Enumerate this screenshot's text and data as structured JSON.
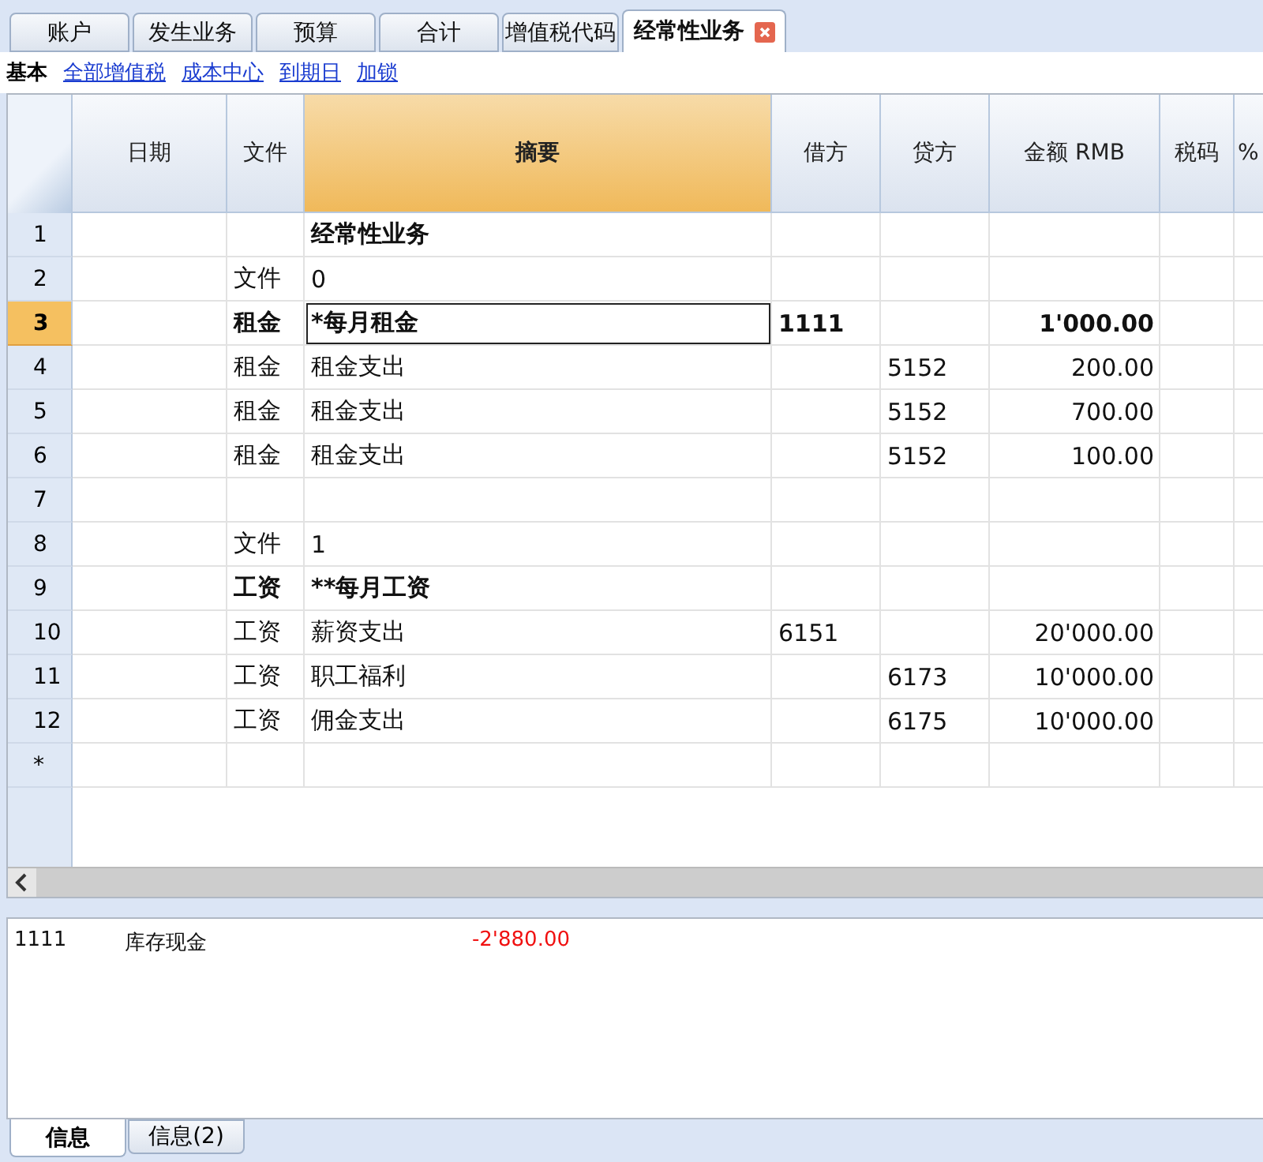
{
  "tabs": [
    {
      "label": "账户",
      "selected": false
    },
    {
      "label": "发生业务",
      "selected": false
    },
    {
      "label": "预算",
      "selected": false
    },
    {
      "label": "合计",
      "selected": false
    },
    {
      "label": "增值税代码",
      "selected": false
    },
    {
      "label": "经常性业务",
      "selected": true,
      "closable": true
    }
  ],
  "views": [
    {
      "label": "基本",
      "selected": true
    },
    {
      "label": "全部增值税",
      "selected": false
    },
    {
      "label": "成本中心",
      "selected": false
    },
    {
      "label": "到期日",
      "selected": false
    },
    {
      "label": "加锁",
      "selected": false
    }
  ],
  "table": {
    "columns": [
      {
        "label": "日期",
        "selected": false
      },
      {
        "label": "文件",
        "selected": false
      },
      {
        "label": "摘要",
        "selected": true
      },
      {
        "label": "借方",
        "selected": false
      },
      {
        "label": "贷方",
        "selected": false
      },
      {
        "label": "金额 RMB",
        "selected": false
      },
      {
        "label": "税码",
        "selected": false
      },
      {
        "label": "%",
        "selected": false
      }
    ],
    "rows": [
      {
        "number": "1",
        "selected": false,
        "bold": true,
        "cells": [
          "",
          "",
          "经常性业务",
          "",
          "",
          "",
          "",
          ""
        ]
      },
      {
        "number": "2",
        "selected": false,
        "bold": false,
        "cells": [
          "",
          "文件",
          "0",
          "",
          "",
          "",
          "",
          ""
        ]
      },
      {
        "number": "3",
        "selected": true,
        "bold": true,
        "cells": [
          "",
          "租金",
          "*每月租金",
          "1111",
          "",
          "1'000.00",
          "",
          ""
        ]
      },
      {
        "number": "4",
        "selected": false,
        "bold": false,
        "cells": [
          "",
          "租金",
          "租金支出",
          "",
          "5152",
          "200.00",
          "",
          ""
        ]
      },
      {
        "number": "5",
        "selected": false,
        "bold": false,
        "cells": [
          "",
          "租金",
          "租金支出",
          "",
          "5152",
          "700.00",
          "",
          ""
        ]
      },
      {
        "number": "6",
        "selected": false,
        "bold": false,
        "cells": [
          "",
          "租金",
          "租金支出",
          "",
          "5152",
          "100.00",
          "",
          ""
        ]
      },
      {
        "number": "7",
        "selected": false,
        "cells": [
          "",
          "",
          "",
          "",
          "",
          "",
          "",
          ""
        ]
      },
      {
        "number": "8",
        "selected": false,
        "bold": false,
        "cells": [
          "",
          "文件",
          "1",
          "",
          "",
          "",
          "",
          ""
        ]
      },
      {
        "number": "9",
        "selected": false,
        "bold": true,
        "cells": [
          "",
          "工资",
          "**每月工资",
          "",
          "",
          "",
          "",
          ""
        ]
      },
      {
        "number": "10",
        "selected": false,
        "bold": false,
        "cells": [
          "",
          "工资",
          "薪资支出",
          "6151",
          "",
          "20'000.00",
          "",
          ""
        ]
      },
      {
        "number": "11",
        "selected": false,
        "bold": false,
        "cells": [
          "",
          "工资",
          "职工福利",
          "",
          "6173",
          "10'000.00",
          "",
          ""
        ]
      },
      {
        "number": "12",
        "selected": false,
        "bold": false,
        "cells": [
          "",
          "工资",
          "佣金支出",
          "",
          "6175",
          "10'000.00",
          "",
          ""
        ]
      },
      {
        "number": "*",
        "selected": false,
        "cells": [
          "",
          "",
          "",
          "",
          "",
          "",
          "",
          ""
        ]
      }
    ]
  },
  "info": {
    "rows": [
      {
        "account": "1111",
        "name": "库存现金",
        "amount": "-2'880.00",
        "negative": true
      }
    ]
  },
  "bottom_tabs": [
    {
      "label": "信息",
      "selected": true
    },
    {
      "label": "信息(2)",
      "selected": false
    }
  ]
}
